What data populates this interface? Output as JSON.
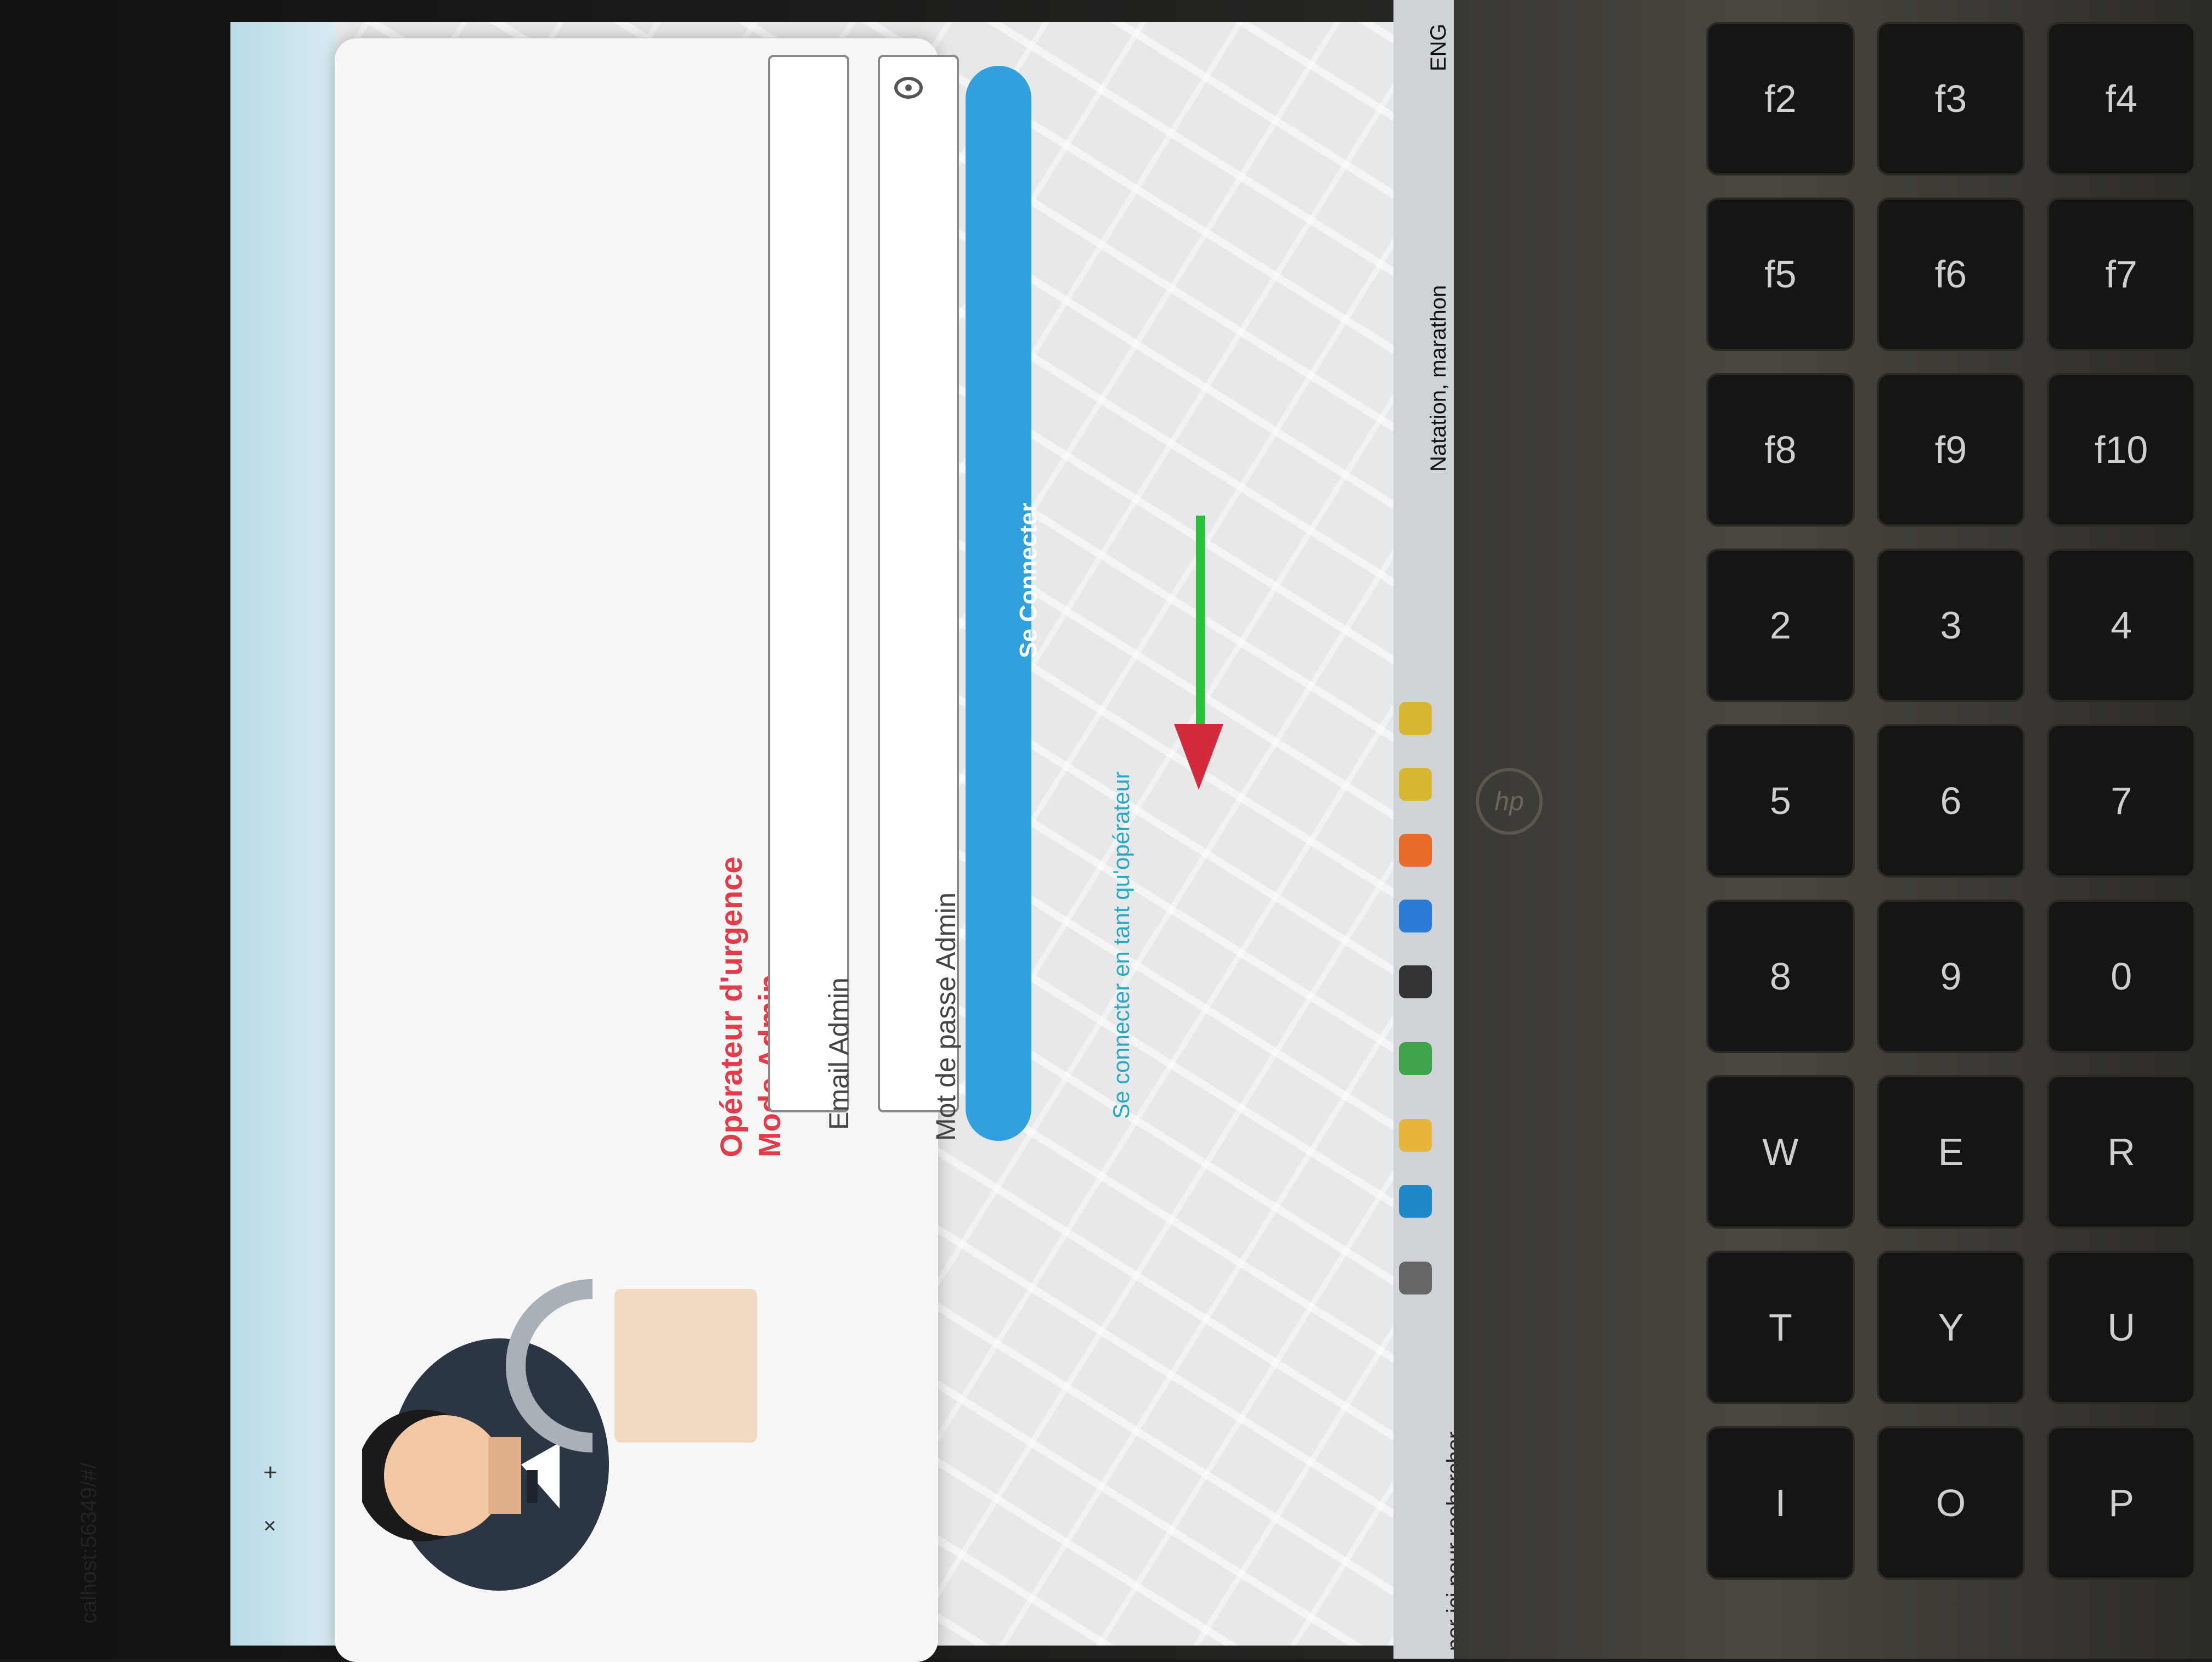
{
  "browser": {
    "tab_close": "×",
    "new_tab": "+",
    "url": "calhost:56349/#/"
  },
  "login": {
    "title_line1": "Opérateur d'urgence",
    "title_line2": "Mode Admin",
    "email_placeholder": "Email Admin",
    "password_placeholder": "Mot de passe Admin",
    "submit_label": "Se Connecter",
    "operator_link": "Se connecter en tant qu'opérateur"
  },
  "taskbar": {
    "search_text": "per ici pour rechercher",
    "weather": "Natation, marathon",
    "language": "ENG",
    "icons": [
      "task-view-icon",
      "edge-icon",
      "file-explorer-icon",
      "store-icon",
      "mail-icon",
      "vscode-icon",
      "app-icon",
      "chrome-icon",
      "chrome-icon"
    ]
  },
  "keyboard": {
    "keys": [
      "f2",
      "f3",
      "f4",
      "f5",
      "f6",
      "f7",
      "f8",
      "f9",
      "f10",
      "2",
      "3",
      "4",
      "5",
      "6",
      "7",
      "8",
      "9",
      "0",
      "W",
      "E",
      "R",
      "T",
      "Y",
      "U",
      "I",
      "O",
      "P"
    ]
  },
  "colors": {
    "title": "#e23b4a",
    "button": "#32a0dc",
    "link": "#2aa8c2"
  }
}
